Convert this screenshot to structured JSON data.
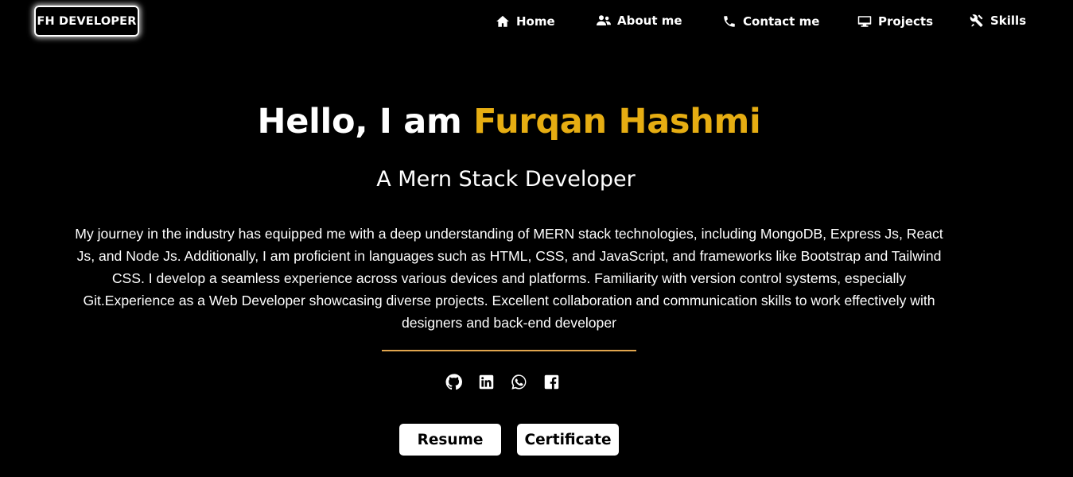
{
  "brand": {
    "logo_text": "FH DEVELOPER"
  },
  "nav": {
    "items": [
      {
        "label": "Home",
        "icon": "home-icon"
      },
      {
        "label": "About me",
        "icon": "users-icon"
      },
      {
        "label": "Contact me",
        "icon": "phone-icon"
      },
      {
        "label": "Projects",
        "icon": "desktop-icon"
      },
      {
        "label": "Skills",
        "icon": "tools-icon"
      }
    ]
  },
  "hero": {
    "greeting": "Hello, I am ",
    "name": "Furqan Hashmi",
    "subtitle": "A Mern Stack Developer",
    "bio": "My journey in the industry has equipped me with a deep understanding of MERN stack technologies, including MongoDB, Express Js, React Js, and Node Js. Additionally, I am proficient in languages such as HTML, CSS, and JavaScript, and frameworks like Bootstrap and Tailwind CSS. I develop a seamless experience across various devices and platforms. Familiarity with version control systems, especially Git.Experience as a Web Developer showcasing diverse projects. Excellent collaboration and communication skills to work effectively with designers and back-end developer"
  },
  "socials": [
    "github-icon",
    "linkedin-icon",
    "whatsapp-icon",
    "facebook-icon"
  ],
  "buttons": {
    "resume": "Resume",
    "certificate": "Certificate"
  },
  "colors": {
    "background": "#000000",
    "accent_name": "#e6ad12",
    "divider": "#e1a64e",
    "text": "#ffffff"
  }
}
